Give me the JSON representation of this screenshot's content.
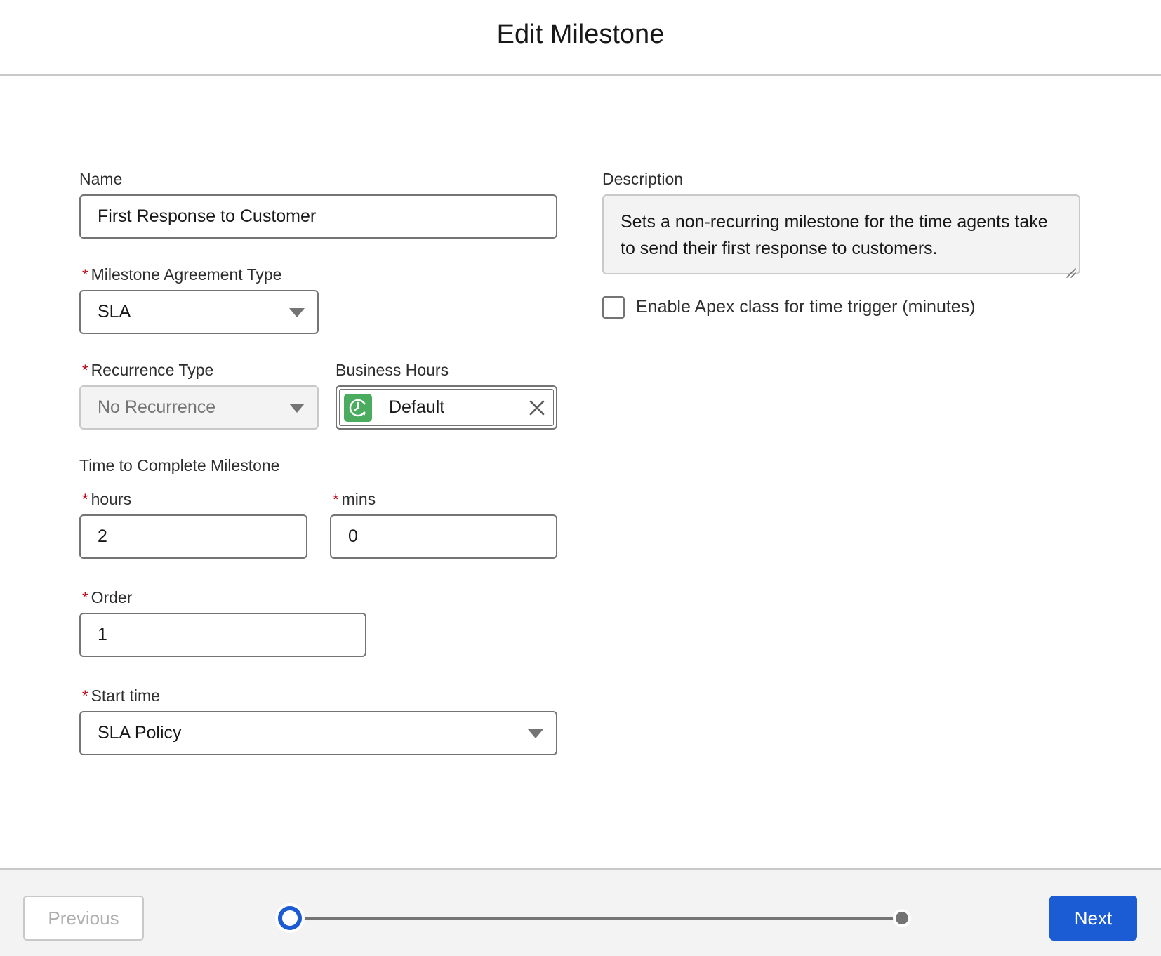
{
  "modal": {
    "title": "Edit Milestone"
  },
  "form": {
    "name": {
      "label": "Name",
      "value": "First Response to Customer"
    },
    "milestone_agreement_type": {
      "required_marker": "*",
      "label": "Milestone Agreement Type",
      "value": "SLA"
    },
    "recurrence_type": {
      "required_marker": "*",
      "label": "Recurrence Type",
      "value": "No Recurrence"
    },
    "business_hours": {
      "label": "Business Hours",
      "value": "Default",
      "icon": "clock-icon",
      "icon_color": "#4bab5f"
    },
    "time_to_complete": {
      "section_label": "Time to Complete Milestone",
      "hours": {
        "required_marker": "*",
        "label": "hours",
        "value": "2"
      },
      "mins": {
        "required_marker": "*",
        "label": "mins",
        "value": "0"
      }
    },
    "order": {
      "required_marker": "*",
      "label": "Order",
      "value": "1"
    },
    "start_time": {
      "required_marker": "*",
      "label": "Start time",
      "value": "SLA Policy"
    },
    "description": {
      "label": "Description",
      "value": "Sets a non-recurring milestone for the time agents take to send their first response to customers."
    },
    "apex_checkbox": {
      "label": "Enable Apex class for time trigger (minutes)",
      "checked": false
    }
  },
  "footer": {
    "previous_label": "Previous",
    "next_label": "Next",
    "progress": {
      "current_step": 1,
      "total_steps": 2
    }
  },
  "colors": {
    "primary": "#1b5bd3",
    "required": "#ba0517",
    "border": "#747474"
  }
}
